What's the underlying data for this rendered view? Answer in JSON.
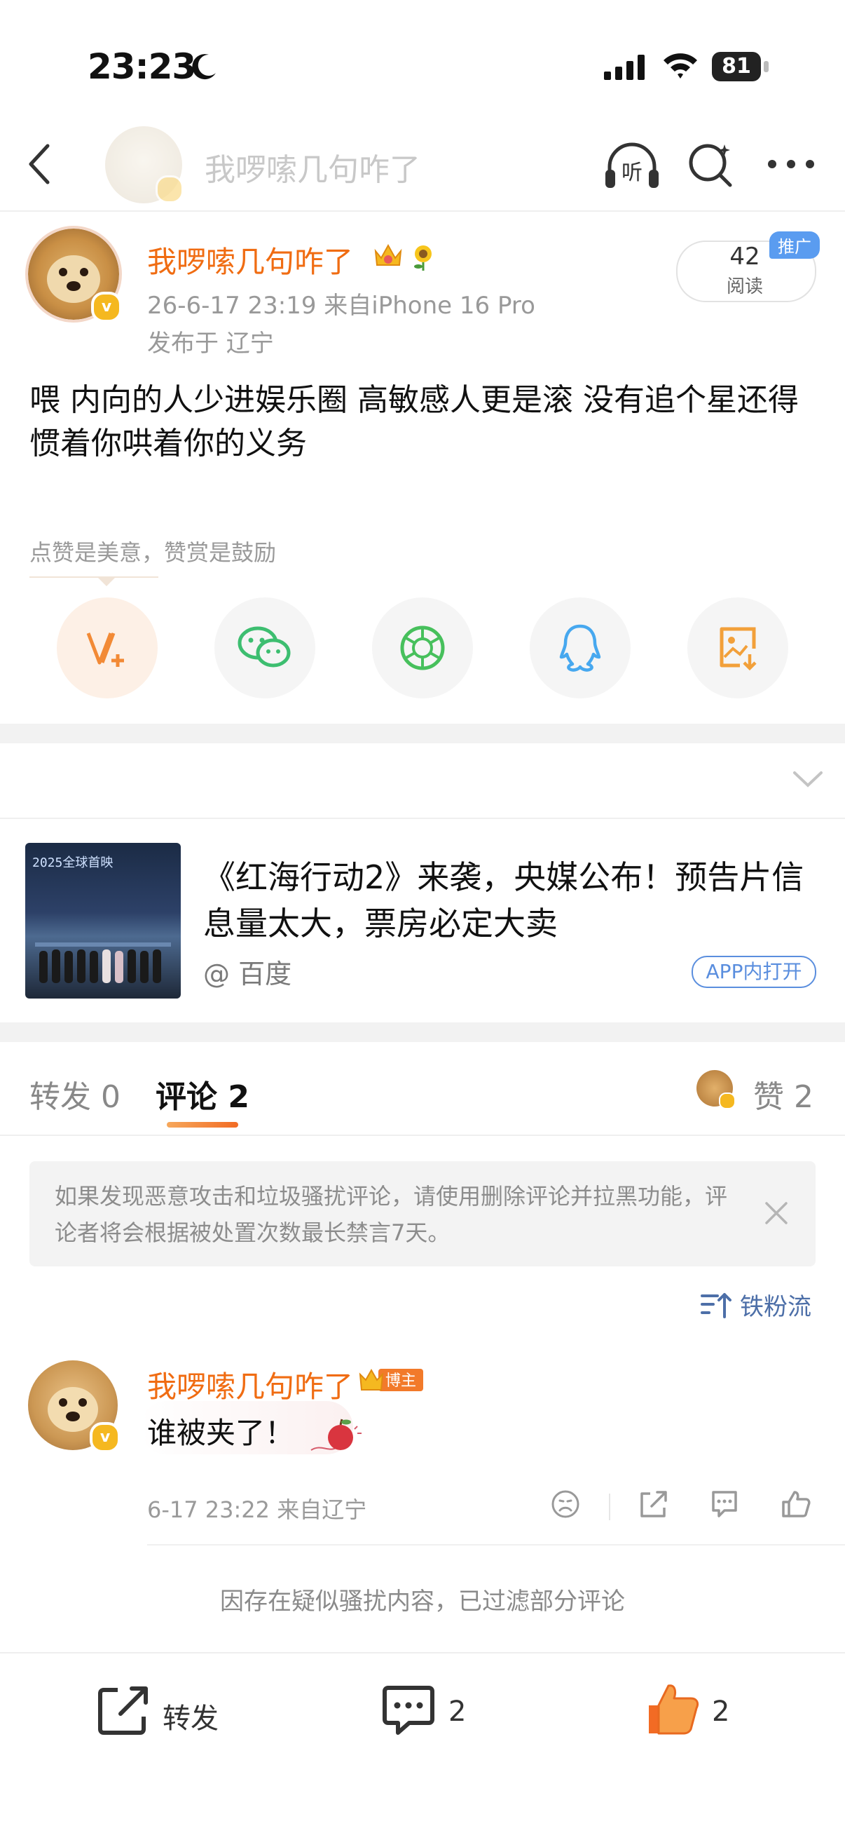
{
  "status_bar": {
    "time": "23:23",
    "battery": "81"
  },
  "nav": {
    "title": "我啰嗦几句咋了"
  },
  "post": {
    "author": "我啰嗦几句咋了",
    "meta": "26-6-17 23:19  来自iPhone 16 Pro",
    "location": "发布于 辽宁",
    "reads": "42",
    "reads_label": "阅读",
    "promo": "推广",
    "text": "喂 内向的人少进娱乐圈 高敏感人更是滚 没有追个星还得惯着你哄着你的义务",
    "tip": "点赞是美意，赞赏是鼓励"
  },
  "share_icons": [
    "vplus-icon",
    "wechat-icon",
    "moments-icon",
    "qq-icon",
    "save-image-icon"
  ],
  "link_card": {
    "thumb_text": "2025全球首映",
    "title": "《红海行动2》来袭，央媒公布！预告片信息量太大，票房必定大卖",
    "source": "@ 百度",
    "open_app": "APP内打开"
  },
  "tabs": {
    "repost": "转发 0",
    "comment": "评论 2",
    "like": "赞 2"
  },
  "notice": {
    "text": "如果发现恶意攻击和垃圾骚扰评论，请使用删除评论并拉黑功能，评论者将会根据被处置次数最长禁言7天。"
  },
  "sort": {
    "label": "铁粉流"
  },
  "comment": {
    "author": "我啰嗦几句咋了",
    "badge": "博主",
    "text": "谁被夹了！",
    "time": "6-17 23:22  来自辽宁"
  },
  "filter_note": "因存在疑似骚扰内容，已过滤部分评论",
  "bottom_bar": {
    "repost": "转发",
    "comments": "2",
    "likes": "2"
  },
  "colors": {
    "accent_orange": "#f06c12",
    "link_blue": "#5a8ede",
    "like_orange": "#f07a2a"
  }
}
